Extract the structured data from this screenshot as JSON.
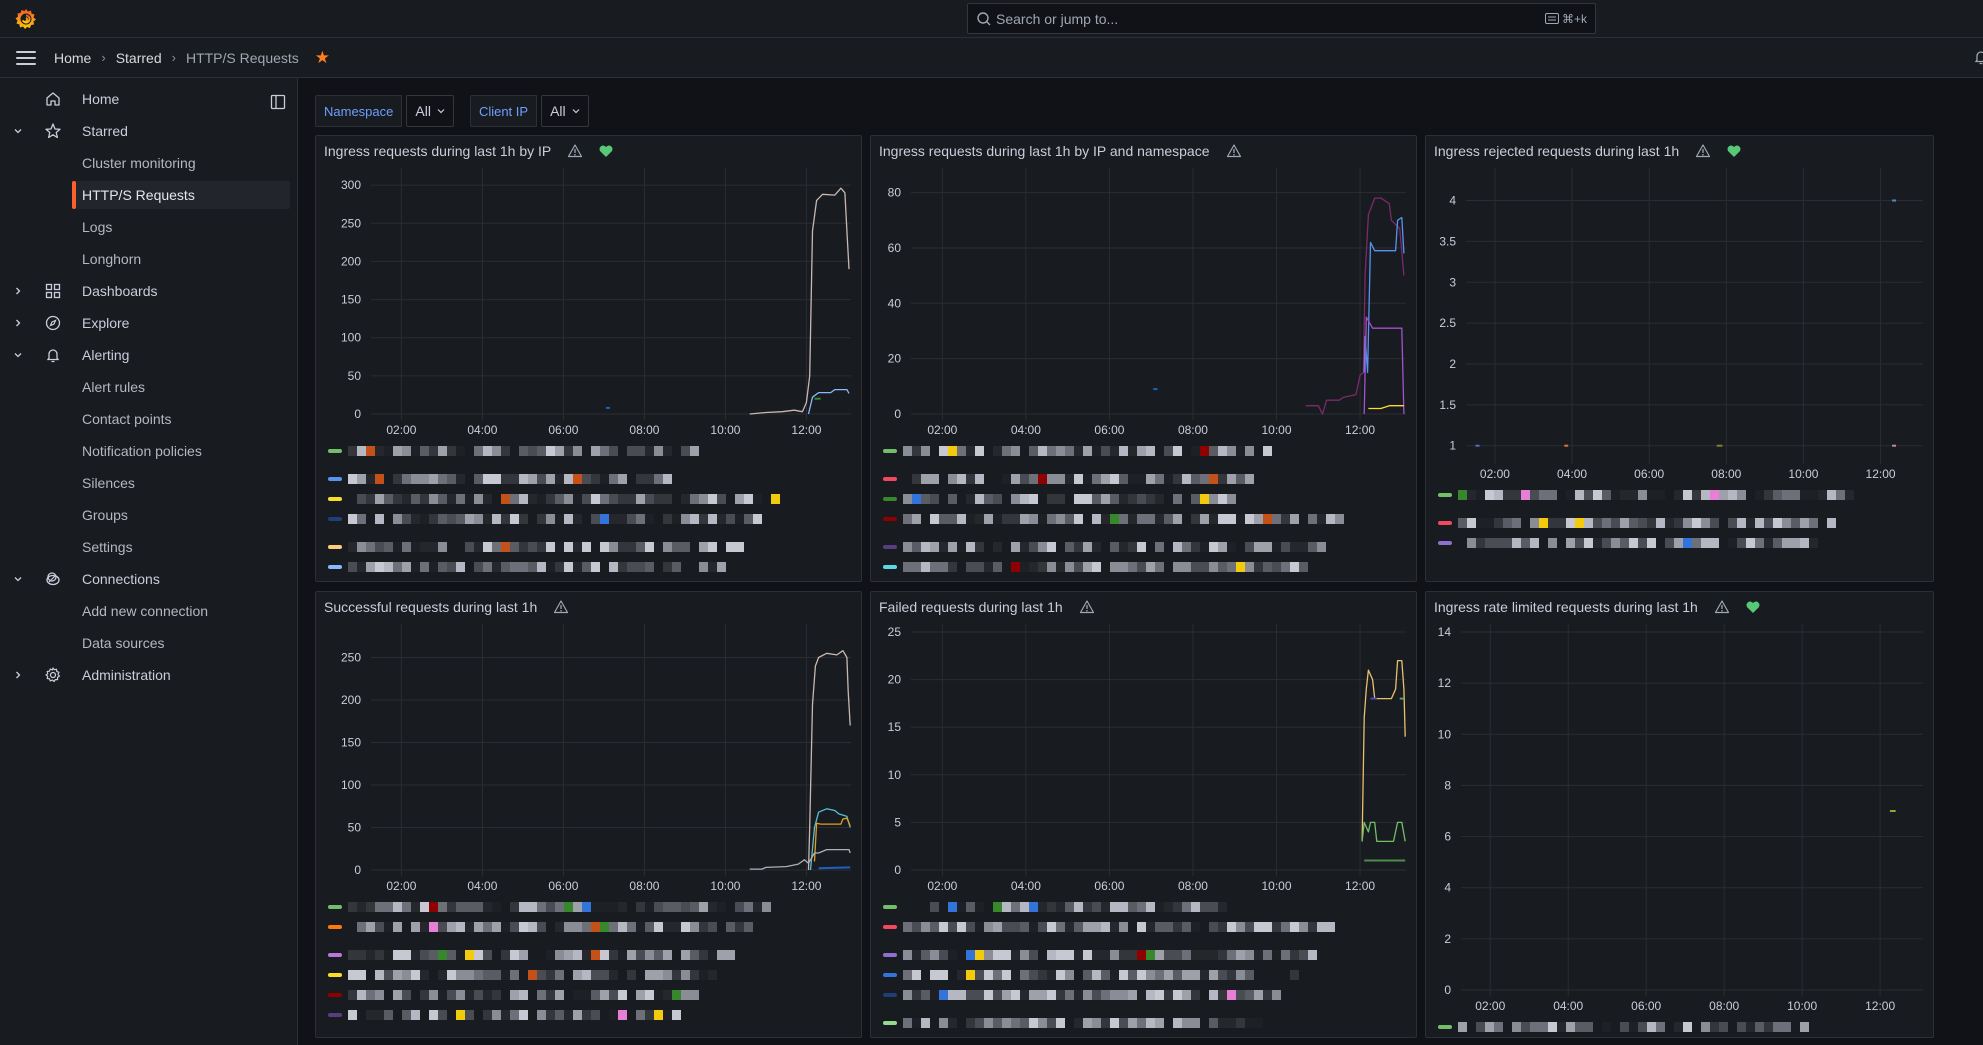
{
  "topbar": {
    "search_placeholder": "Search or jump to...",
    "search_shortcut": "⌘+k"
  },
  "breadcrumb": {
    "items": [
      "Home",
      "Starred",
      "HTTP/S Requests"
    ],
    "starred": true
  },
  "sidebar": {
    "items": [
      {
        "label": "Home",
        "icon": "home-icon",
        "level": 0,
        "chevron": "",
        "active": false
      },
      {
        "label": "Starred",
        "icon": "star-icon",
        "level": 0,
        "chevron": "down",
        "active": false
      },
      {
        "label": "Cluster monitoring",
        "icon": "",
        "level": 1,
        "chevron": "",
        "active": false
      },
      {
        "label": "HTTP/S Requests",
        "icon": "",
        "level": 1,
        "chevron": "",
        "active": true
      },
      {
        "label": "Logs",
        "icon": "",
        "level": 1,
        "chevron": "",
        "active": false
      },
      {
        "label": "Longhorn",
        "icon": "",
        "level": 1,
        "chevron": "",
        "active": false
      },
      {
        "label": "Dashboards",
        "icon": "apps-icon",
        "level": 0,
        "chevron": "right",
        "active": false
      },
      {
        "label": "Explore",
        "icon": "compass-icon",
        "level": 0,
        "chevron": "right",
        "active": false
      },
      {
        "label": "Alerting",
        "icon": "bell-icon",
        "level": 0,
        "chevron": "down",
        "active": false
      },
      {
        "label": "Alert rules",
        "icon": "",
        "level": 1,
        "chevron": "",
        "active": false
      },
      {
        "label": "Contact points",
        "icon": "",
        "level": 1,
        "chevron": "",
        "active": false
      },
      {
        "label": "Notification policies",
        "icon": "",
        "level": 1,
        "chevron": "",
        "active": false
      },
      {
        "label": "Silences",
        "icon": "",
        "level": 1,
        "chevron": "",
        "active": false
      },
      {
        "label": "Groups",
        "icon": "",
        "level": 1,
        "chevron": "",
        "active": false
      },
      {
        "label": "Settings",
        "icon": "",
        "level": 1,
        "chevron": "",
        "active": false
      },
      {
        "label": "Connections",
        "icon": "link-icon",
        "level": 0,
        "chevron": "down",
        "active": false
      },
      {
        "label": "Add new connection",
        "icon": "",
        "level": 1,
        "chevron": "",
        "active": false
      },
      {
        "label": "Data sources",
        "icon": "",
        "level": 1,
        "chevron": "",
        "active": false
      },
      {
        "label": "Administration",
        "icon": "cog-icon",
        "level": 0,
        "chevron": "right",
        "active": false
      }
    ]
  },
  "variables": [
    {
      "label": "Namespace",
      "value": "All"
    },
    {
      "label": "Client IP",
      "value": "All"
    }
  ],
  "colors": {
    "accent": "#ff5f2e",
    "link": "#6e9fff",
    "heart": "#56c878",
    "star": "#ff7f1f"
  },
  "chart_data": [
    {
      "type": "line",
      "title": "Ingress requests during last 1h by IP",
      "warning_icon": true,
      "health_icon": true,
      "x_ticks": [
        "02:00",
        "04:00",
        "06:00",
        "08:00",
        "10:00",
        "12:00"
      ],
      "x_range": [
        1.25,
        13.1
      ],
      "y_ticks": [
        0,
        50,
        100,
        150,
        200,
        250,
        300
      ],
      "ylim": [
        0,
        312
      ],
      "series": [
        {
          "name": "series-1",
          "color": "#c9b8b0",
          "points": [
            [
              10.6,
              0
            ],
            [
              11.0,
              2
            ],
            [
              11.4,
              3
            ],
            [
              11.7,
              5
            ],
            [
              11.9,
              3
            ],
            [
              12.0,
              15
            ],
            [
              12.08,
              50
            ],
            [
              12.15,
              240
            ],
            [
              12.25,
              280
            ],
            [
              12.4,
              288
            ],
            [
              12.7,
              287
            ],
            [
              12.85,
              296
            ],
            [
              12.95,
              290
            ],
            [
              13.0,
              240
            ],
            [
              13.05,
              190
            ]
          ]
        },
        {
          "name": "series-2",
          "color": "#8ab8ff",
          "points": [
            [
              12.05,
              0
            ],
            [
              12.15,
              22
            ],
            [
              12.3,
              28
            ],
            [
              12.6,
              28
            ],
            [
              12.7,
              32
            ],
            [
              13.0,
              32
            ],
            [
              13.05,
              27
            ]
          ]
        },
        {
          "name": "series-3",
          "color": "#1f60c4",
          "points": [
            [
              7.05,
              8
            ],
            [
              7.15,
              8
            ]
          ]
        },
        {
          "name": "series-4",
          "color": "#37872d",
          "points": [
            [
              12.2,
              20
            ],
            [
              12.35,
              20
            ]
          ]
        }
      ],
      "legend_colors": [
        "#73bf69",
        "#5794f2",
        "#fade2a",
        "#1f3f77",
        "#ffcb7d",
        "#8ab8ff"
      ],
      "legend_gaps_after": [
        0,
        3
      ]
    },
    {
      "type": "line",
      "title": "Ingress requests during last 1h by IP and namespace",
      "warning_icon": true,
      "health_icon": false,
      "x_ticks": [
        "02:00",
        "04:00",
        "06:00",
        "08:00",
        "10:00",
        "12:00"
      ],
      "x_range": [
        1.25,
        13.1
      ],
      "y_ticks": [
        0,
        20,
        40,
        60,
        80
      ],
      "ylim": [
        0,
        86
      ],
      "series": [
        {
          "name": "series-1",
          "color": "#7c2a6b",
          "points": [
            [
              10.7,
              3
            ],
            [
              11.0,
              3
            ],
            [
              11.1,
              0
            ],
            [
              11.2,
              5
            ],
            [
              11.5,
              5
            ],
            [
              11.6,
              6
            ],
            [
              11.9,
              7
            ],
            [
              12.0,
              14
            ],
            [
              12.08,
              15
            ],
            [
              12.12,
              50
            ],
            [
              12.2,
              72
            ],
            [
              12.35,
              78
            ],
            [
              12.5,
              78
            ],
            [
              12.7,
              76
            ],
            [
              12.75,
              70
            ],
            [
              12.95,
              67
            ],
            [
              13.05,
              50
            ]
          ]
        },
        {
          "name": "series-2",
          "color": "#5794f2",
          "points": [
            [
              12.1,
              15
            ],
            [
              12.12,
              28
            ],
            [
              12.18,
              15
            ],
            [
              12.25,
              62
            ],
            [
              12.35,
              59
            ],
            [
              12.85,
              59
            ],
            [
              12.9,
              70
            ],
            [
              13.0,
              71
            ],
            [
              13.05,
              58
            ]
          ]
        },
        {
          "name": "series-3",
          "color": "#a352cc",
          "points": [
            [
              12.1,
              0
            ],
            [
              12.15,
              35
            ],
            [
              12.3,
              31
            ],
            [
              13.0,
              31
            ],
            [
              13.05,
              0
            ]
          ]
        },
        {
          "name": "series-4",
          "color": "#fade2a",
          "points": [
            [
              12.2,
              2
            ],
            [
              12.5,
              2
            ],
            [
              12.7,
              3
            ],
            [
              13.05,
              3
            ]
          ]
        },
        {
          "name": "series-5",
          "color": "#1f60c4",
          "points": [
            [
              7.05,
              9
            ],
            [
              7.15,
              9
            ]
          ]
        }
      ],
      "legend_colors": [
        "#73bf69",
        "#f2495c",
        "#37872d",
        "#8f0000",
        "#5a3d80",
        "#5ad8e6"
      ],
      "legend_gaps_after": [
        0,
        3
      ]
    },
    {
      "type": "line",
      "title": "Ingress rejected requests during last 1h",
      "warning_icon": true,
      "health_icon": true,
      "x_ticks": [
        "02:00",
        "04:00",
        "06:00",
        "08:00",
        "10:00",
        "12:00"
      ],
      "x_range": [
        1.25,
        13.1
      ],
      "y_ticks": [
        1,
        1.5,
        2,
        2.5,
        3,
        3.5,
        4
      ],
      "ylim": [
        0.85,
        4.3
      ],
      "series": [
        {
          "name": "series-1",
          "color": "#5a6fc0",
          "points": [
            [
              1.5,
              1
            ],
            [
              1.6,
              1
            ]
          ]
        },
        {
          "name": "series-2",
          "color": "#e0752d",
          "points": [
            [
              3.8,
              1
            ],
            [
              3.9,
              1
            ]
          ]
        },
        {
          "name": "series-3",
          "color": "#808030",
          "points": [
            [
              7.75,
              1
            ],
            [
              7.9,
              1
            ]
          ]
        },
        {
          "name": "series-4",
          "color": "#c49090",
          "points": [
            [
              12.3,
              1
            ],
            [
              12.4,
              1
            ]
          ]
        },
        {
          "name": "series-5",
          "color": "#4f8fbf",
          "points": [
            [
              12.3,
              4
            ],
            [
              12.4,
              4
            ]
          ]
        }
      ],
      "legend_colors": [
        "#73bf69",
        "#f2495c",
        "#8f6fd0"
      ],
      "legend_gaps_after": [
        0
      ]
    },
    {
      "type": "line",
      "title": "Successful requests during last 1h",
      "warning_icon": true,
      "health_icon": false,
      "x_ticks": [
        "02:00",
        "04:00",
        "06:00",
        "08:00",
        "10:00",
        "12:00"
      ],
      "x_range": [
        1.25,
        13.1
      ],
      "y_ticks": [
        0,
        50,
        100,
        150,
        200,
        250
      ],
      "ylim": [
        0,
        280
      ],
      "series": [
        {
          "name": "series-1",
          "color": "#c9b8b0",
          "points": [
            [
              12.05,
              0
            ],
            [
              12.08,
              50
            ],
            [
              12.15,
              195
            ],
            [
              12.22,
              240
            ],
            [
              12.3,
              250
            ],
            [
              12.5,
              255
            ],
            [
              12.75,
              253
            ],
            [
              12.9,
              258
            ],
            [
              13.0,
              250
            ],
            [
              13.03,
              210
            ],
            [
              13.08,
              170
            ]
          ]
        },
        {
          "name": "series-2",
          "color": "#5ac0d8",
          "points": [
            [
              12.1,
              0
            ],
            [
              12.2,
              50
            ],
            [
              12.3,
              68
            ],
            [
              12.5,
              72
            ],
            [
              12.7,
              70
            ],
            [
              12.8,
              66
            ],
            [
              13.0,
              63
            ],
            [
              13.08,
              50
            ]
          ]
        },
        {
          "name": "series-3",
          "color": "#e0a020",
          "points": [
            [
              12.2,
              10
            ],
            [
              12.25,
              55
            ],
            [
              12.35,
              54
            ],
            [
              12.85,
              54
            ],
            [
              12.9,
              60
            ],
            [
              13.0,
              61
            ],
            [
              13.08,
              52
            ]
          ]
        },
        {
          "name": "series-4",
          "color": "#b0b0b8",
          "points": [
            [
              10.6,
              1
            ],
            [
              10.9,
              1
            ],
            [
              11.0,
              3
            ],
            [
              11.5,
              4
            ],
            [
              11.8,
              7
            ],
            [
              11.95,
              12
            ],
            [
              12.05,
              8
            ],
            [
              12.2,
              20
            ],
            [
              12.3,
              20
            ],
            [
              12.5,
              24
            ],
            [
              13.05,
              24
            ],
            [
              13.08,
              20
            ]
          ]
        },
        {
          "name": "series-5",
          "color": "#1f60c4",
          "points": [
            [
              12.3,
              2
            ],
            [
              13.08,
              3
            ]
          ]
        }
      ],
      "legend_colors": [
        "#73bf69",
        "#ff780a",
        "#b877d9",
        "#fade2a",
        "#8f0000",
        "#5a3d80"
      ],
      "legend_gaps_after": [
        1
      ]
    },
    {
      "type": "line",
      "title": "Failed requests during last 1h",
      "warning_icon": true,
      "health_icon": false,
      "x_ticks": [
        "02:00",
        "04:00",
        "06:00",
        "08:00",
        "10:00",
        "12:00"
      ],
      "x_range": [
        1.25,
        13.1
      ],
      "y_ticks": [
        0,
        5,
        10,
        15,
        20,
        25
      ],
      "ylim": [
        0,
        25
      ],
      "series": [
        {
          "name": "series-1",
          "color": "#e8c070",
          "points": [
            [
              12.05,
              3
            ],
            [
              12.1,
              16
            ],
            [
              12.15,
              19
            ],
            [
              12.2,
              21
            ],
            [
              12.3,
              20
            ],
            [
              12.35,
              18
            ],
            [
              12.75,
              18
            ],
            [
              12.85,
              19
            ],
            [
              12.9,
              22
            ],
            [
              13.0,
              22
            ],
            [
              13.05,
              19
            ],
            [
              13.08,
              14
            ]
          ]
        },
        {
          "name": "series-2",
          "color": "#73bf69",
          "points": [
            [
              12.05,
              3
            ],
            [
              12.1,
              5
            ],
            [
              12.2,
              4
            ],
            [
              12.25,
              5
            ],
            [
              12.35,
              5
            ],
            [
              12.4,
              3
            ],
            [
              12.8,
              3
            ],
            [
              12.9,
              5
            ],
            [
              13.0,
              5
            ],
            [
              13.08,
              3
            ]
          ]
        },
        {
          "name": "series-3",
          "color": "#4e8a4e",
          "points": [
            [
              12.1,
              1
            ],
            [
              13.08,
              1
            ]
          ]
        },
        {
          "name": "series-4",
          "color": "#4a4ac0",
          "points": [
            [
              12.25,
              18
            ],
            [
              12.4,
              18
            ]
          ]
        },
        {
          "name": "series-5",
          "color": "#58a070",
          "points": [
            [
              12.95,
              18
            ],
            [
              13.05,
              18
            ]
          ]
        }
      ],
      "legend_colors": [
        "#73bf69",
        "#f2495c",
        "#8f6fd0",
        "#3274d9",
        "#1f3f77",
        "#96d98d"
      ],
      "legend_gaps_after": [
        1,
        4
      ]
    },
    {
      "type": "line",
      "title": "Ingress rate limited requests during last 1h",
      "warning_icon": true,
      "health_icon": true,
      "x_ticks": [
        "02:00",
        "04:00",
        "06:00",
        "08:00",
        "10:00",
        "12:00"
      ],
      "x_range": [
        1.25,
        13.1
      ],
      "y_ticks": [
        0,
        2,
        4,
        6,
        8,
        10,
        12,
        14
      ],
      "ylim": [
        0,
        14
      ],
      "series": [
        {
          "name": "series-1",
          "color": "#a0a030",
          "points": [
            [
              12.25,
              7
            ],
            [
              12.4,
              7
            ]
          ]
        }
      ],
      "legend_colors": [
        "#73bf69"
      ],
      "legend_gaps_after": []
    }
  ]
}
